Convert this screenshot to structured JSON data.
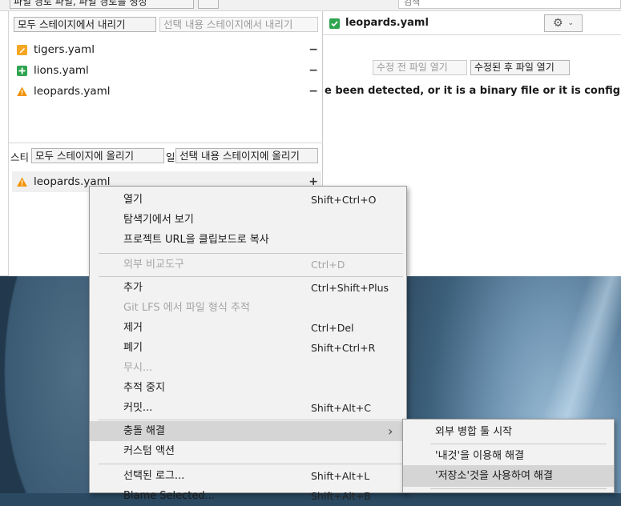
{
  "topbar": {
    "partial_label": "파일 경로 파일, 파일 경로를 생성",
    "right_partial": "검색"
  },
  "unstaged": {
    "unstage_all": "모두 스테이지에서 내리기",
    "unstage_selected": "선택 내용 스테이지에서 내리기",
    "files": [
      {
        "name": "tigers.yaml",
        "status": "modified",
        "action": "−"
      },
      {
        "name": "lions.yaml",
        "status": "added",
        "action": "−"
      },
      {
        "name": "leopards.yaml",
        "status": "conflict",
        "action": "−"
      }
    ]
  },
  "staged": {
    "label_prefix": "스티",
    "label_suffix": "일",
    "stage_all": "모두 스테이지에 올리기",
    "stage_selected": "선택 내용 스테이지에 올리기",
    "files": [
      {
        "name": "leopards.yaml",
        "status": "conflict",
        "action": "+"
      }
    ]
  },
  "diff": {
    "file_name": "leopards.yaml",
    "open_before": "수정 전 파일 열기",
    "open_after": "수정된 후 파일 열기",
    "message": "e been detected, or it is a binary file or it is configured to be i"
  },
  "colors": {
    "modified": "#f5a623",
    "added": "#2ea44f",
    "conflict": "#f29100",
    "checkbox": "#2ea44f"
  },
  "menu": {
    "items": [
      {
        "label": "열기",
        "shortcut": "Shift+Ctrl+O"
      },
      {
        "label": "탐색기에서 보기",
        "shortcut": ""
      },
      {
        "label": "프로젝트 URL을 클립보드로 복사",
        "shortcut": ""
      },
      {
        "label": "외부 비교도구",
        "shortcut": "Ctrl+D"
      },
      {
        "label": "추가",
        "shortcut": "Ctrl+Shift+Plus"
      },
      {
        "label": "Git LFS 에서 파일 형식 추적",
        "shortcut": ""
      },
      {
        "label": "제거",
        "shortcut": "Ctrl+Del"
      },
      {
        "label": "폐기",
        "shortcut": "Shift+Ctrl+R"
      },
      {
        "label": "무시...",
        "shortcut": ""
      },
      {
        "label": "추적 중지",
        "shortcut": ""
      },
      {
        "label": "커밋...",
        "shortcut": "Shift+Alt+C"
      },
      {
        "label": "충돌 해결",
        "shortcut": ""
      },
      {
        "label": "커스텀 액션",
        "shortcut": ""
      },
      {
        "label": "선택된 로그...",
        "shortcut": "Shift+Alt+L"
      },
      {
        "label": "Blame Selected...",
        "shortcut": "Shift+Alt+B"
      }
    ],
    "submenu_arrow": "›"
  },
  "submenu": {
    "items": [
      {
        "label": "외부 병합 툴 시작"
      },
      {
        "label": "'내것'을 이용해 해결"
      },
      {
        "label": "'저장소'것을 사용하여 해결"
      }
    ]
  }
}
